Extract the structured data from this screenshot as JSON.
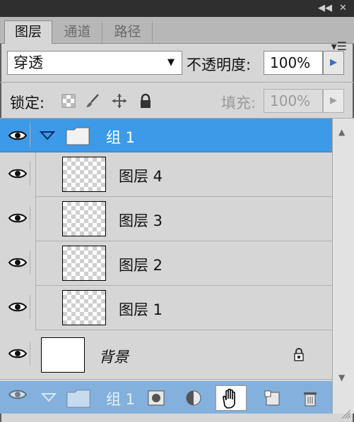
{
  "titlebar": {
    "collapse_icon": "◀◀",
    "close_icon": "✕"
  },
  "tabs": [
    {
      "label": "图层",
      "active": true
    },
    {
      "label": "通道",
      "active": false
    },
    {
      "label": "路径",
      "active": false
    }
  ],
  "panel_menu_icon": "▾☰",
  "blend_mode": {
    "value": "穿透",
    "arrow": "▼"
  },
  "opacity": {
    "label": "不透明度:",
    "value": "100%",
    "arrow": "▶"
  },
  "lock": {
    "label": "锁定:",
    "icons": [
      "lock-transparent-icon",
      "lock-paint-brush-icon",
      "lock-position-move-icon",
      "lock-all-icon"
    ]
  },
  "fill": {
    "label": "填充:",
    "value": "100%",
    "arrow": "▶",
    "enabled": false
  },
  "layers": [
    {
      "name": "组 1",
      "type": "group",
      "selected": true,
      "visible": true,
      "expanded": true
    },
    {
      "name": "图层 4",
      "type": "layer",
      "selected": false,
      "visible": true
    },
    {
      "name": "图层 3",
      "type": "layer",
      "selected": false,
      "visible": true
    },
    {
      "name": "图层 2",
      "type": "layer",
      "selected": false,
      "visible": true
    },
    {
      "name": "图层 1",
      "type": "layer",
      "selected": false,
      "visible": true
    },
    {
      "name": "背景",
      "type": "background",
      "selected": false,
      "visible": true,
      "locked": true
    }
  ],
  "drag_ghost": {
    "name": "组 1"
  },
  "scrollbar": {
    "up": "▲",
    "down": "▼"
  },
  "colors": {
    "selection": "#3d9ae8",
    "panel_bg": "#d6d6d6",
    "titlebar": "#2f2f2f"
  }
}
